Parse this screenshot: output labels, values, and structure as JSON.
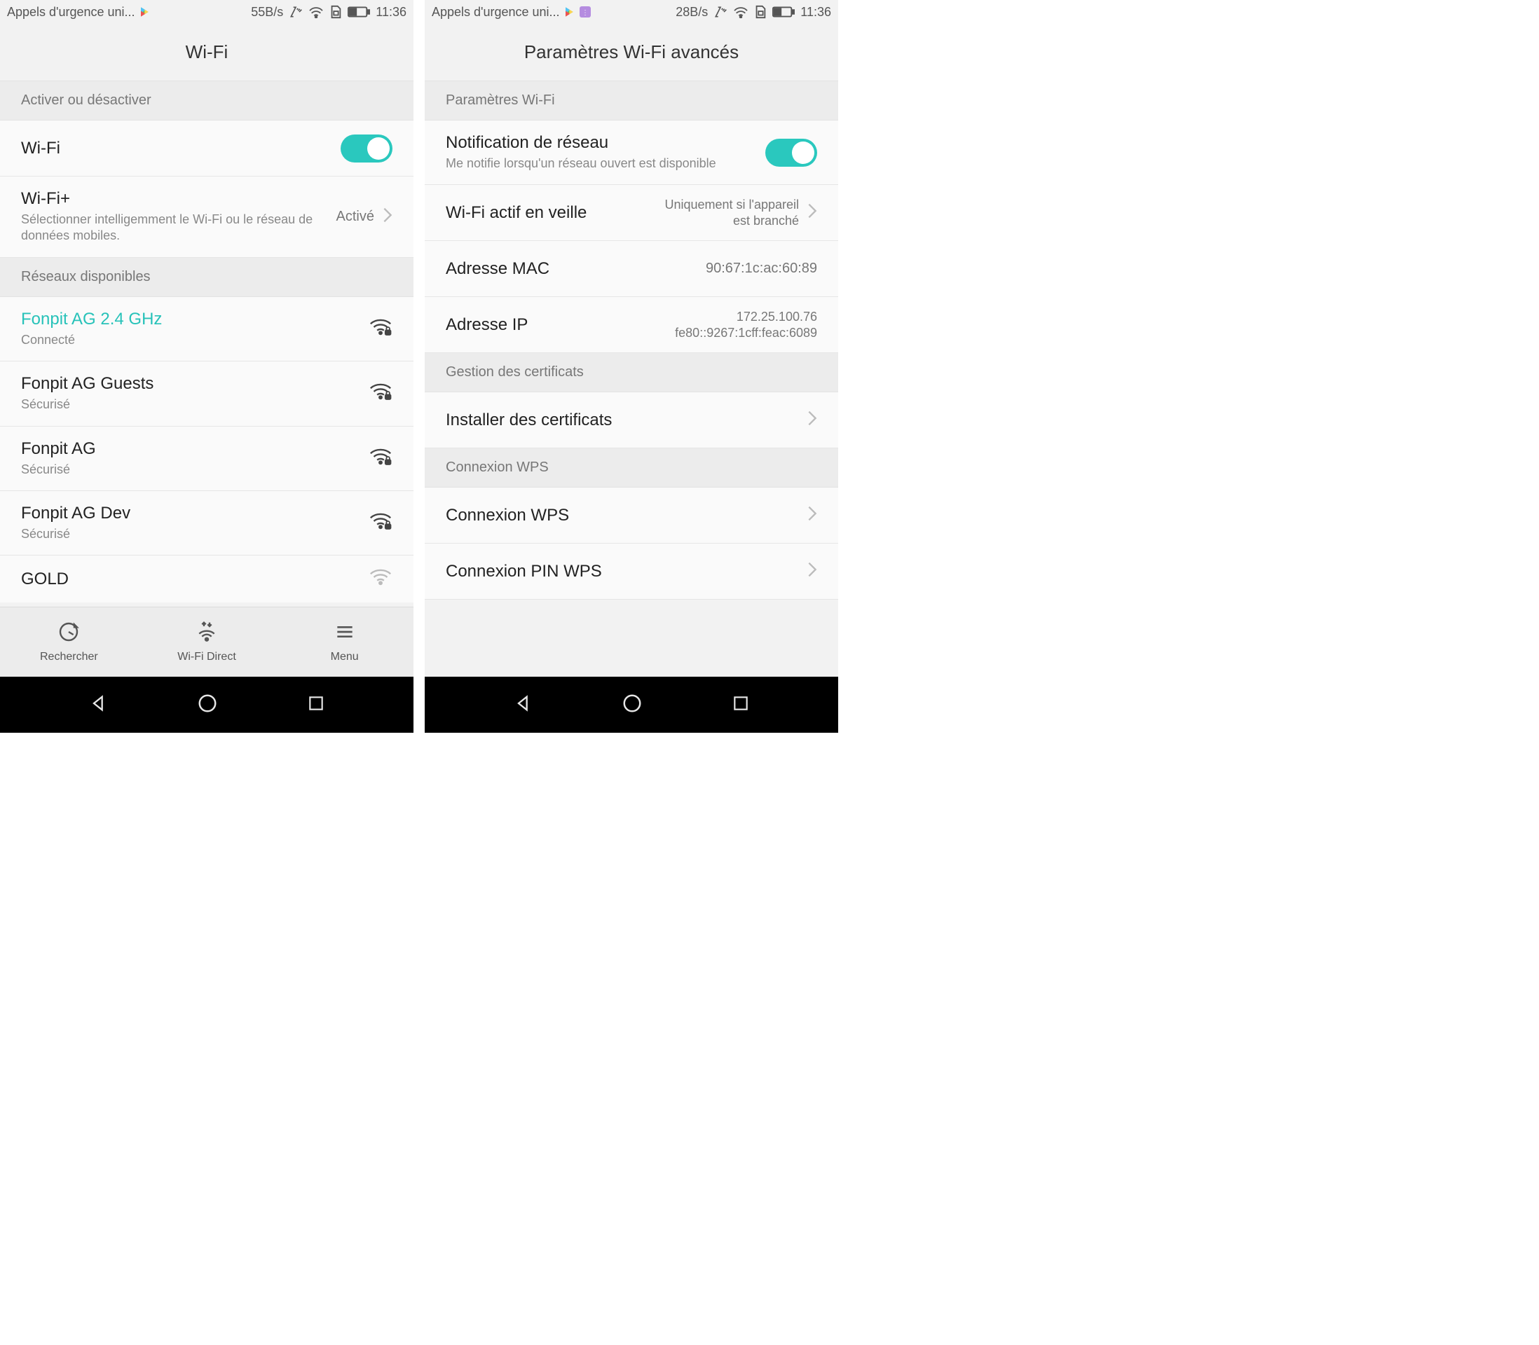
{
  "left": {
    "status": {
      "carrier": "Appels d'urgence uni...",
      "speed": "55B/s",
      "time": "11:36"
    },
    "title": "Wi-Fi",
    "section_toggle": "Activer ou désactiver",
    "wifi_toggle": "Wi-Fi",
    "wifi_plus": {
      "title": "Wi-Fi+",
      "sub": "Sélectionner intelligemment le Wi-Fi ou le réseau de données mobiles.",
      "value": "Activé"
    },
    "section_networks": "Réseaux disponibles",
    "networks": [
      {
        "name": "Fonpit AG 2.4 GHz",
        "status": "Connecté",
        "accent": true
      },
      {
        "name": "Fonpit AG Guests",
        "status": "Sécurisé",
        "accent": false
      },
      {
        "name": "Fonpit AG",
        "status": "Sécurisé",
        "accent": false
      },
      {
        "name": "Fonpit AG Dev",
        "status": "Sécurisé",
        "accent": false
      },
      {
        "name": "GOLD",
        "status": "",
        "accent": false
      }
    ],
    "toolbar": {
      "search": "Rechercher",
      "direct": "Wi-Fi Direct",
      "menu": "Menu"
    }
  },
  "right": {
    "status": {
      "carrier": "Appels d'urgence uni...",
      "speed": "28B/s",
      "time": "11:36"
    },
    "title": "Paramètres Wi-Fi avancés",
    "section_params": "Paramètres Wi-Fi",
    "notif": {
      "title": "Notification de réseau",
      "sub": "Me notifie lorsqu'un réseau ouvert est disponible"
    },
    "sleep": {
      "title": "Wi-Fi actif en veille",
      "value": "Uniquement si l'appareil est branché"
    },
    "mac": {
      "title": "Adresse MAC",
      "value": "90:67:1c:ac:60:89"
    },
    "ip": {
      "title": "Adresse IP",
      "value1": "172.25.100.76",
      "value2": "fe80::9267:1cff:feac:6089"
    },
    "section_cert": "Gestion des certificats",
    "install_cert": "Installer des certificats",
    "section_wps": "Connexion WPS",
    "wps_conn": "Connexion WPS",
    "wps_pin": "Connexion PIN WPS"
  }
}
